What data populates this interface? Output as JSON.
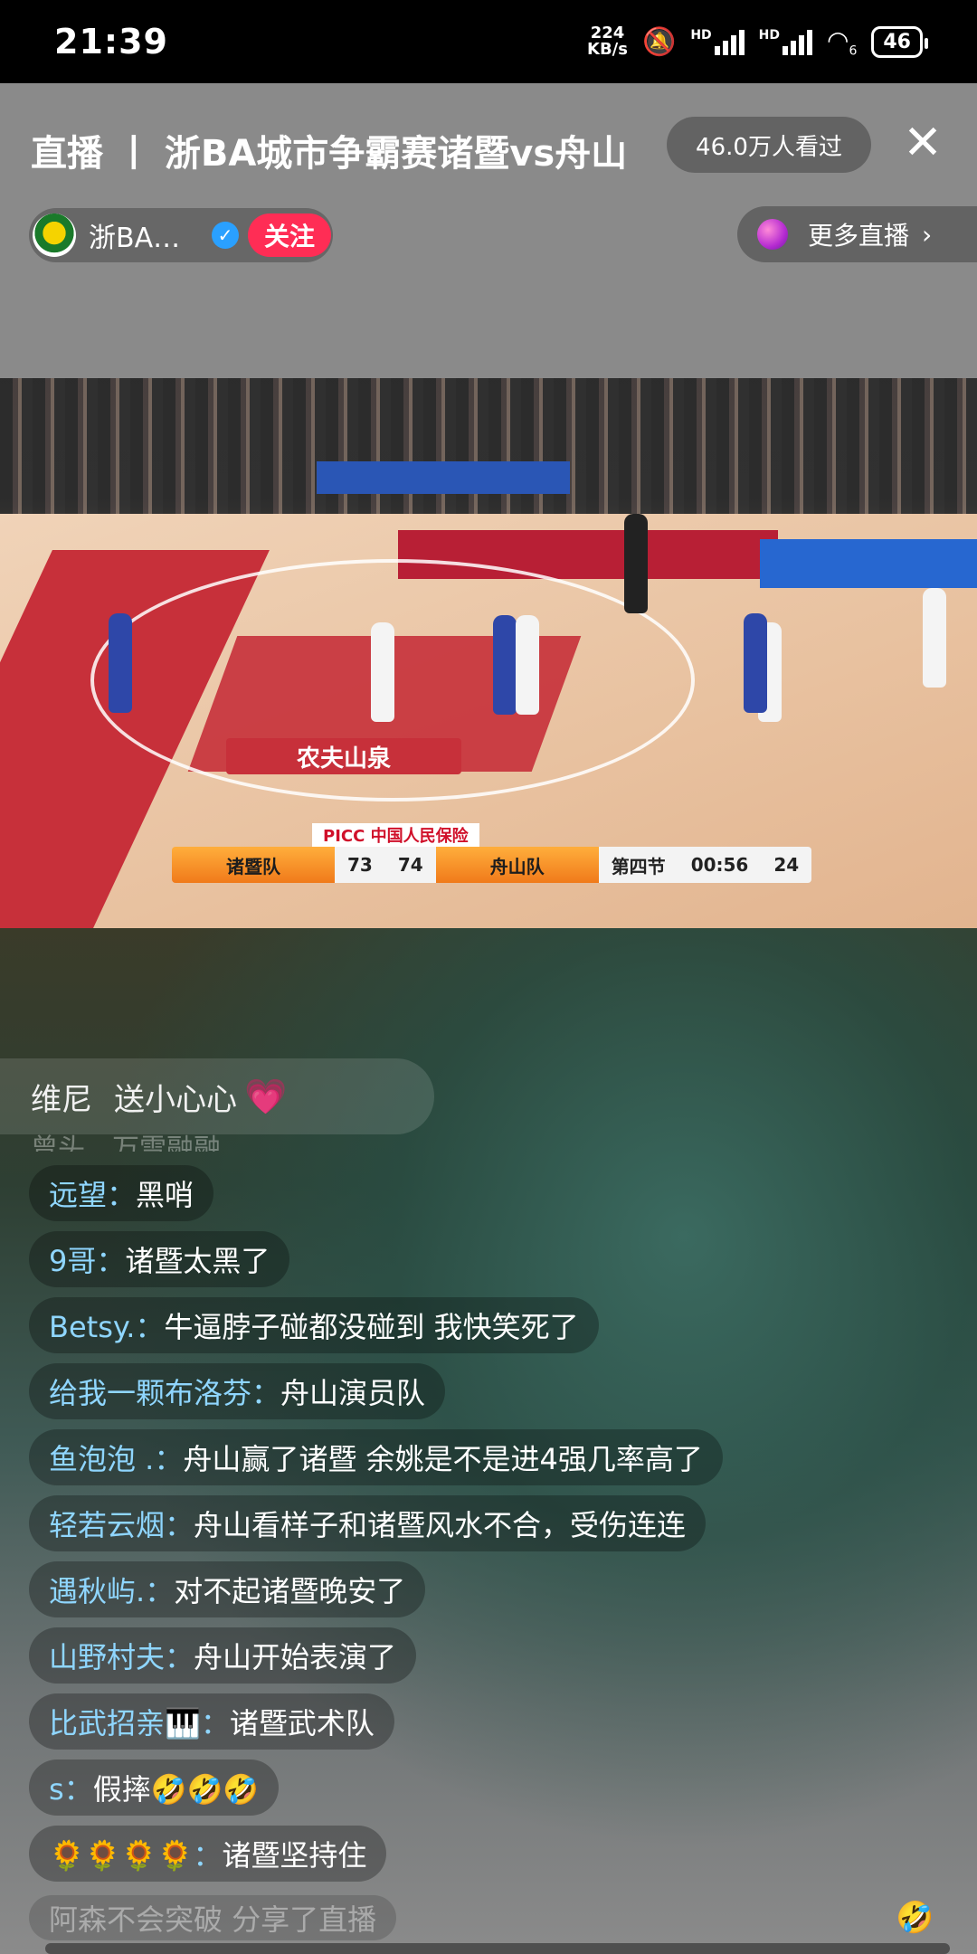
{
  "status_bar": {
    "time": "21:39",
    "net_speed_value": "224",
    "net_speed_unit": "KB/s",
    "hd1": "HD",
    "hd2": "HD",
    "wifi_label": "6",
    "battery": "46"
  },
  "header": {
    "title": "直播 丨 浙BA城市争霸赛诸暨vs舟山",
    "views": "46.0万人看过",
    "close_icon": "close-icon"
  },
  "anchor": {
    "name": "浙BA…",
    "follow_label": "关注"
  },
  "more_live": {
    "label": "更多直播",
    "chevron": "›"
  },
  "video": {
    "sponsor": "PICC 中国人民保险",
    "scoreboard": {
      "home_team": "诸暨队",
      "home_score": "73",
      "away_score": "74",
      "away_team": "舟山队",
      "period": "第四节",
      "clock": "00:56",
      "shot_clock": "24"
    },
    "floor_text": "农夫山泉"
  },
  "gift_notice": {
    "user": "维尼",
    "action": "送小心心",
    "icon": "heart-icon"
  },
  "chat": {
    "faded_top": "曾头…万雪融融",
    "messages": [
      {
        "user": "远望：",
        "text": "黑哨"
      },
      {
        "user": "9哥：",
        "text": "诸暨太黑了"
      },
      {
        "user": "Betsy.：",
        "text": "牛逼脖子碰都没碰到 我快笑死了"
      },
      {
        "user": "给我一颗布洛芬：",
        "text": "舟山演员队"
      },
      {
        "user": "鱼泡泡 .：",
        "text": "舟山赢了诸暨 余姚是不是进4强几率高了"
      },
      {
        "user": "轻若云烟：",
        "text": "舟山看样子和诸暨风水不合，受伤连连"
      },
      {
        "user": "遇秋屿.：",
        "text": "对不起诸暨晚安了"
      },
      {
        "user": "山野村夫：",
        "text": "舟山开始表演了"
      },
      {
        "user": "比武招亲🎹：",
        "text": "诸暨武术队"
      },
      {
        "user": "s：",
        "text": "假摔🤣🤣🤣"
      },
      {
        "user": "🌻🌻🌻🌻：",
        "text": "诸暨坚持住"
      }
    ],
    "faded_bottom": "阿森不会突破 分享了直播"
  },
  "colors": {
    "follow": "#ff2d55",
    "username": "#8fd6ff",
    "verify": "#2aa0ff"
  }
}
